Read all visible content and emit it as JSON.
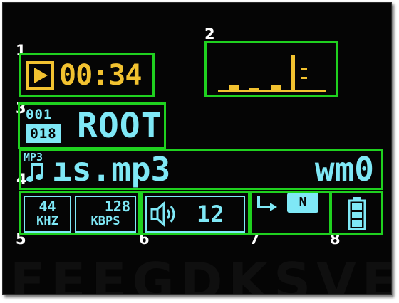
{
  "callout_numbers": [
    "1",
    "2",
    "3",
    "4",
    "5",
    "6",
    "7",
    "8"
  ],
  "colors": {
    "highlight": "#1fd11f",
    "time": "#f2c230",
    "lcd": "#7fe8f6",
    "background": "#050505"
  },
  "playback": {
    "icon": "play-icon",
    "time": "00:34"
  },
  "equalizer": {
    "bar_levels": [
      0.12,
      0.05,
      0.12,
      0.85,
      0.32,
      0.55
    ]
  },
  "folder": {
    "track_current": "001",
    "track_total": "018",
    "name": "ROOT"
  },
  "track": {
    "format": "MP3",
    "icon": "music-note-icon",
    "filename": "ıs.mp3",
    "eq_mode": "wm0"
  },
  "audio": {
    "sample_rate": "44",
    "sample_rate_unit": "KHZ",
    "bitrate": "128",
    "bitrate_unit": "KBPS"
  },
  "volume": {
    "icon": "speaker-icon",
    "level": "12"
  },
  "repeat": {
    "icon": "repeat-icon",
    "mode_letter": "N"
  },
  "battery": {
    "icon": "battery-icon",
    "level": 1.0
  },
  "watermark": "FEEGDKSVE"
}
